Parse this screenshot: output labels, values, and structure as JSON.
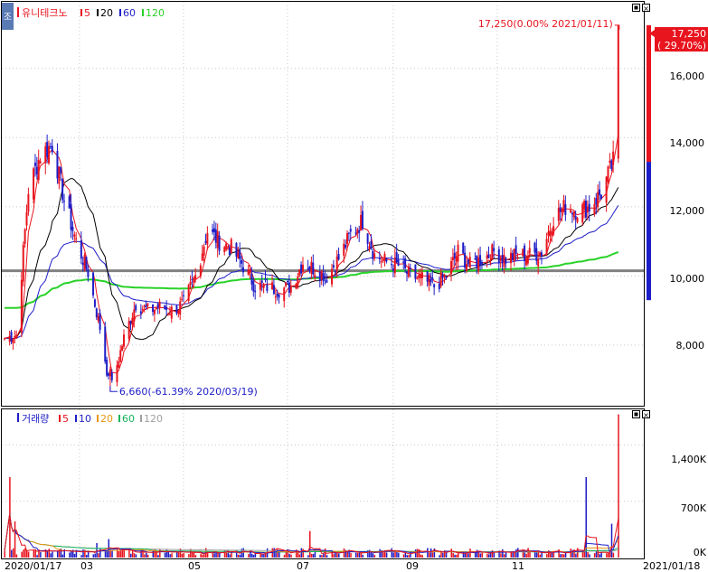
{
  "price_panel": {
    "side_button": "조",
    "legend": {
      "name": "유니테크노",
      "items": [
        {
          "label": "5",
          "color": "#e8141e"
        },
        {
          "label": "20",
          "color": "#000000"
        },
        {
          "label": "60",
          "color": "#1e1ec8"
        },
        {
          "label": "120",
          "color": "#28d228"
        }
      ]
    },
    "annot_high": "17,250(0.00% 2021/01/11)",
    "annot_low": "6,660(-61.39% 2020/03/19)",
    "current_price": "17,250",
    "current_change": "( 29.70%)",
    "y_ticks": [
      "16,000",
      "14,000",
      "12,000",
      "10,000",
      "8,000"
    ]
  },
  "volume_panel": {
    "legend": {
      "name": "거래량",
      "items": [
        {
          "label": "5",
          "color": "#e8141e"
        },
        {
          "label": "10",
          "color": "#1e1ec8"
        },
        {
          "label": "20",
          "color": "#e89614"
        },
        {
          "label": "60",
          "color": "#14b45a"
        },
        {
          "label": "120",
          "color": "#a0a0a0"
        }
      ]
    },
    "y_ticks": [
      "1,400K",
      "700K",
      "0K"
    ]
  },
  "x_labels": [
    "2020/01/17",
    "03",
    "05",
    "07",
    "09",
    "11",
    "2021/01/18"
  ],
  "colors": {
    "up": "#e8141e",
    "down": "#1e1ec8",
    "baseline": "#808080"
  },
  "chart_data": {
    "type": "candlestick",
    "price_ylim": [
      6300,
      17900
    ],
    "volume_ylim": [
      0,
      1820000
    ],
    "x_range": [
      "2020-01-17",
      "2021-01-18"
    ],
    "baseline_price": 10150,
    "price_path": [
      [
        "2020-01-17",
        8200
      ],
      [
        "2020-01-24",
        8300
      ],
      [
        "2020-01-31",
        12500
      ],
      [
        "2020-02-07",
        13500
      ],
      [
        "2020-02-14",
        13800
      ],
      [
        "2020-02-21",
        12200
      ],
      [
        "2020-02-28",
        11000
      ],
      [
        "2020-03-06",
        10100
      ],
      [
        "2020-03-13",
        8500
      ],
      [
        "2020-03-19",
        6660
      ],
      [
        "2020-03-27",
        8200
      ],
      [
        "2020-04-03",
        9200
      ],
      [
        "2020-04-10",
        9000
      ],
      [
        "2020-04-17",
        9100
      ],
      [
        "2020-04-24",
        9000
      ],
      [
        "2020-05-01",
        9200
      ],
      [
        "2020-05-08",
        10000
      ],
      [
        "2020-05-15",
        11300
      ],
      [
        "2020-05-22",
        11000
      ],
      [
        "2020-05-29",
        10800
      ],
      [
        "2020-06-05",
        10300
      ],
      [
        "2020-06-12",
        9700
      ],
      [
        "2020-06-19",
        9700
      ],
      [
        "2020-06-26",
        9600
      ],
      [
        "2020-07-03",
        9700
      ],
      [
        "2020-07-10",
        10400
      ],
      [
        "2020-07-17",
        10200
      ],
      [
        "2020-07-24",
        10000
      ],
      [
        "2020-07-31",
        10500
      ],
      [
        "2020-08-07",
        11200
      ],
      [
        "2020-08-14",
        11600
      ],
      [
        "2020-08-21",
        10600
      ],
      [
        "2020-08-28",
        10400
      ],
      [
        "2020-09-04",
        10300
      ],
      [
        "2020-09-11",
        10000
      ],
      [
        "2020-09-18",
        9900
      ],
      [
        "2020-09-25",
        9700
      ],
      [
        "2020-10-02",
        10000
      ],
      [
        "2020-10-09",
        10700
      ],
      [
        "2020-10-16",
        10300
      ],
      [
        "2020-10-23",
        10500
      ],
      [
        "2020-10-30",
        10700
      ],
      [
        "2020-11-06",
        10500
      ],
      [
        "2020-11-13",
        10600
      ],
      [
        "2020-11-20",
        10600
      ],
      [
        "2020-11-27",
        10700
      ],
      [
        "2020-12-04",
        11700
      ],
      [
        "2020-12-11",
        12000
      ],
      [
        "2020-12-18",
        11900
      ],
      [
        "2020-12-25",
        12000
      ],
      [
        "2021-01-01",
        12400
      ],
      [
        "2021-01-08",
        13300
      ],
      [
        "2021-01-11",
        17250
      ]
    ],
    "ma_last": {
      "ma5": 13300,
      "ma20": 12200,
      "ma60": 11250,
      "ma120": 10850
    },
    "volume_spikes": [
      [
        "2020-01-20",
        1000000
      ],
      [
        "2020-01-23",
        450000
      ],
      [
        "2020-03-11",
        180000
      ],
      [
        "2020-03-18",
        230000
      ],
      [
        "2020-07-14",
        330000
      ],
      [
        "2020-12-23",
        1000000
      ],
      [
        "2021-01-07",
        420000
      ],
      [
        "2021-01-11",
        1780000
      ]
    ]
  }
}
